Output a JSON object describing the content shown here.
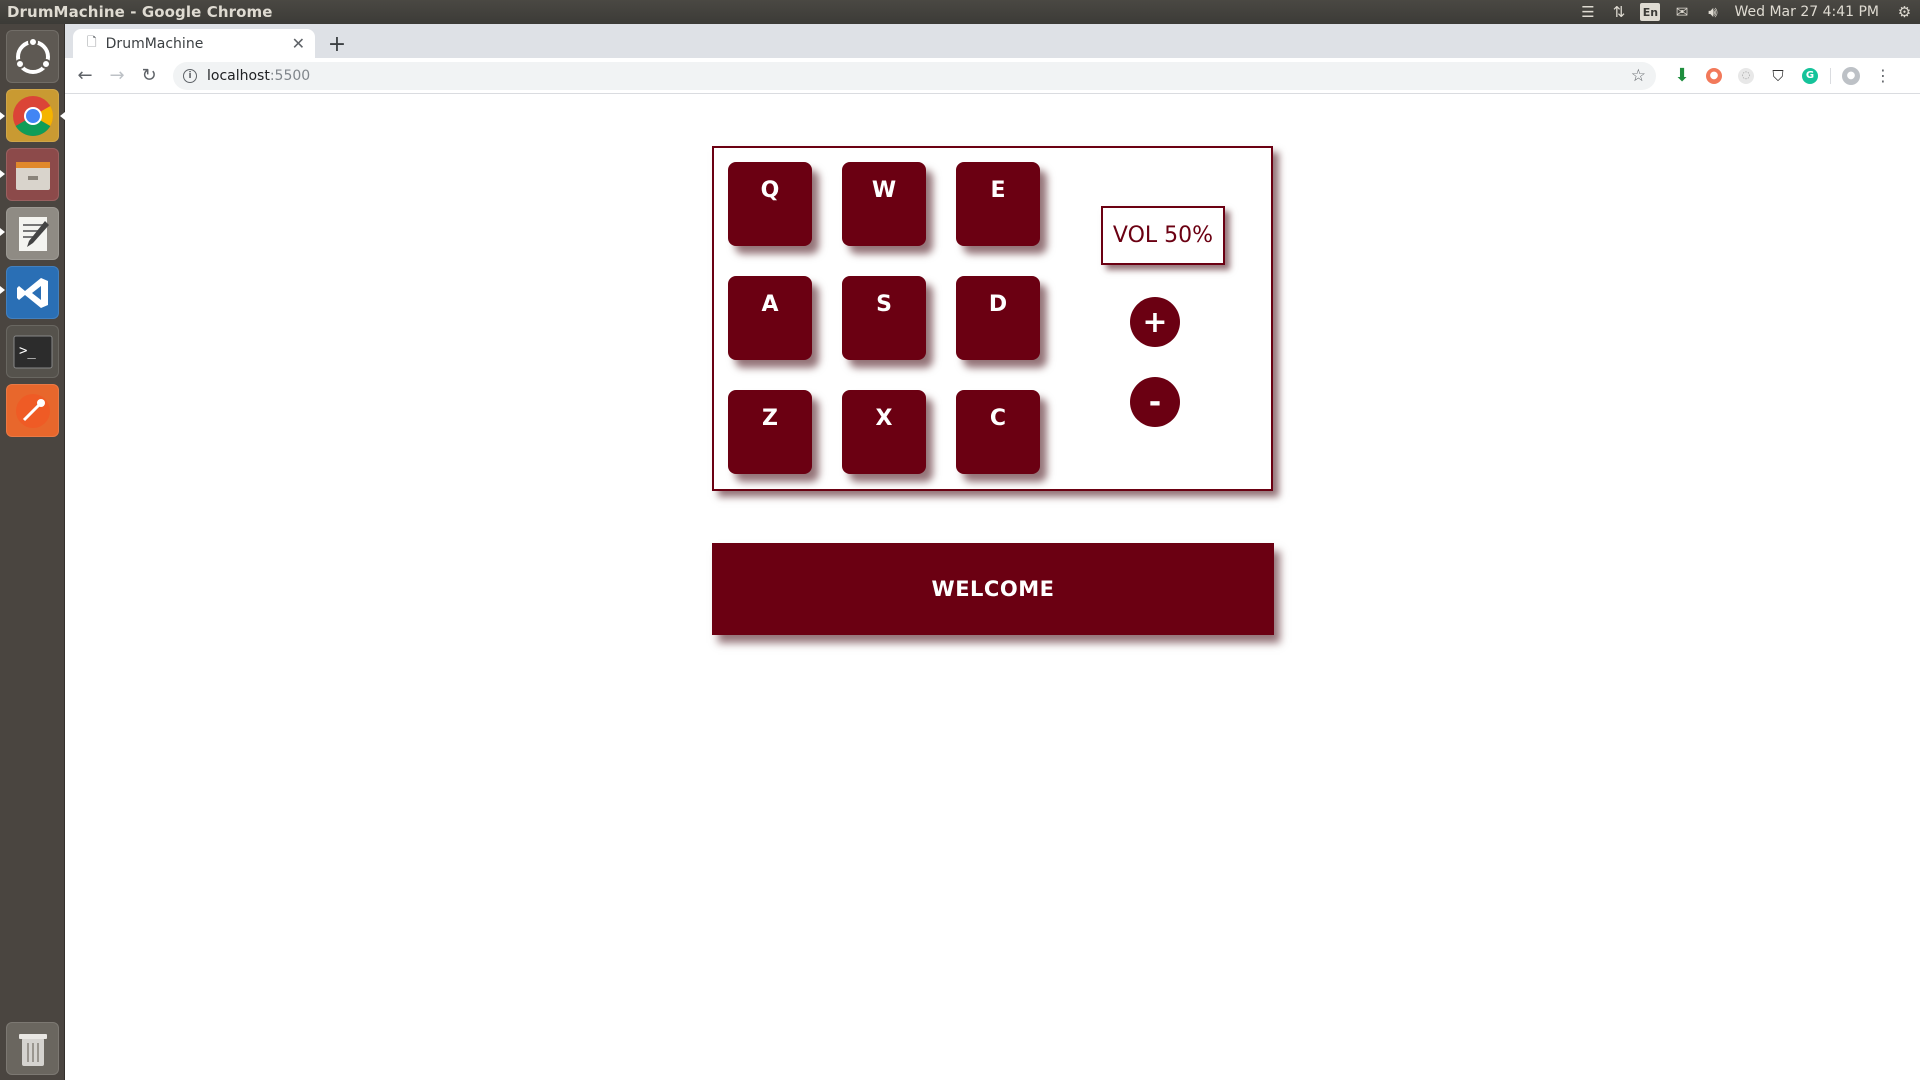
{
  "os": {
    "window_title": "DrumMachine - Google Chrome",
    "tray": {
      "keyboard_layout": "En",
      "clock": "Wed Mar 27  4:41 PM"
    },
    "launcher": [
      {
        "name": "ubuntu-dash-icon"
      },
      {
        "name": "chrome-icon"
      },
      {
        "name": "file-manager-icon"
      },
      {
        "name": "text-editor-icon"
      },
      {
        "name": "vscode-icon"
      },
      {
        "name": "terminal-icon"
      },
      {
        "name": "postman-icon"
      },
      {
        "name": "trash-icon"
      }
    ]
  },
  "browser": {
    "tab_title": "DrumMachine",
    "url_host": "localhost",
    "url_port": ":5500"
  },
  "drum": {
    "pads": [
      "Q",
      "W",
      "E",
      "A",
      "S",
      "D",
      "Z",
      "X",
      "C"
    ],
    "volume_label": "VOL 50%",
    "volume_percent": 50,
    "vol_up": "+",
    "vol_down": "-",
    "display_text": "WELCOME"
  },
  "colors": {
    "accent": "#6b0012",
    "panel_bg": "#3c3b37",
    "launcher_bg": "#4a4540",
    "tabstrip_bg": "#dee1e6"
  }
}
